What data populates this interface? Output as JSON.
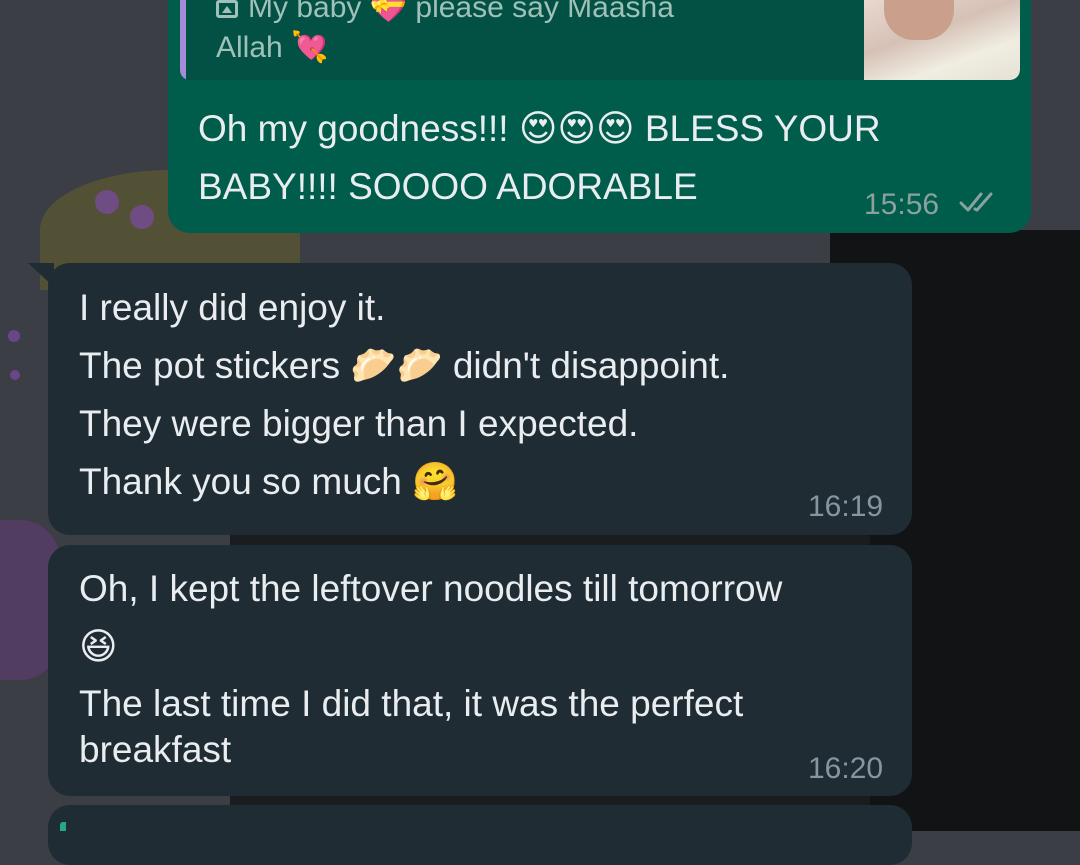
{
  "chat": {
    "quoted": {
      "line1": "My baby 💝 please say Maasha",
      "line2": "Allah 💘",
      "icon": "photo-icon"
    },
    "sent_message": {
      "line1": "Oh my goodness!!! 😍😍😍 BLESS YOUR",
      "line2": "BABY!!!! SOOOO ADORABLE",
      "time": "15:56",
      "status_icon": "double-check-icon"
    },
    "received_1": {
      "lines": [
        "I really did enjoy it.",
        "The pot stickers 🥟🥟 didn't disappoint.",
        "They were bigger than I expected.",
        "Thank you so much 🤗"
      ],
      "time": "16:19"
    },
    "received_2": {
      "lines": [
        "Oh, I kept the leftover noodles till tomorrow",
        "😆",
        "The last time I did that, it was the perfect",
        "breakfast"
      ],
      "time": "16:20"
    }
  },
  "colors": {
    "sent_bubble": "#005c4b",
    "received_bubble": "#202c33",
    "quote_bar": "#a58cd7",
    "text": "#e9edef",
    "meta": "#8696a0"
  }
}
